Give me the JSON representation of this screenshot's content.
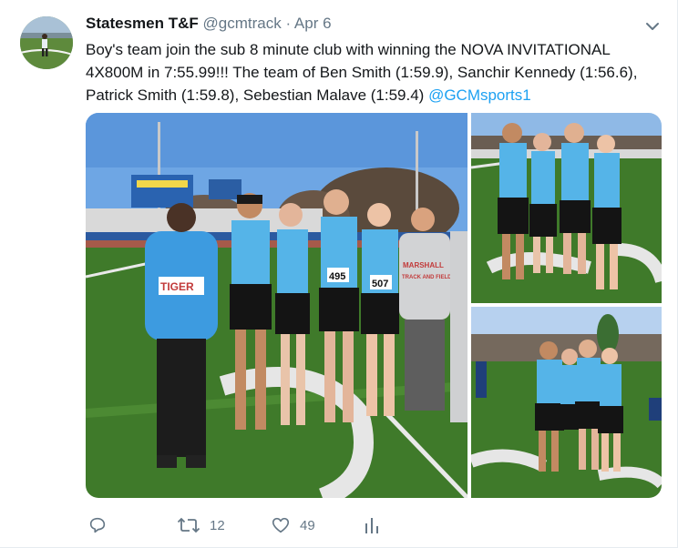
{
  "tweet": {
    "display_name": "Statesmen T&F",
    "handle": "@gcmtrack",
    "separator": "·",
    "date": "Apr 6",
    "text_line1": "Boy's team join the sub 8 minute club with winning the NOVA INVITATIONAL",
    "text_line2": "4X800M in 7:55.99!!!  The team of Ben Smith (1:59.9), Sanchir Kennedy (1:56.6),",
    "text_line3": "Patrick Smith (1:59.8), Sebestian Malave (1:59.4) ",
    "mention": "@GCMsports1"
  },
  "photos": {
    "main_bib_1": "495",
    "main_bib_2": "507",
    "hoodie_text_1": "MARSHALL",
    "hoodie_text_2": "TRACK AND FIELD",
    "jacket_text": "TIGER"
  },
  "actions": {
    "retweet_count": "12",
    "like_count": "49"
  },
  "colors": {
    "link": "#1da1f2",
    "muted": "#657786",
    "text": "#14171a",
    "border": "#e6ecf0"
  },
  "icons": [
    "reply-icon",
    "retweet-icon",
    "like-icon",
    "analytics-icon",
    "chevron-down-icon"
  ]
}
